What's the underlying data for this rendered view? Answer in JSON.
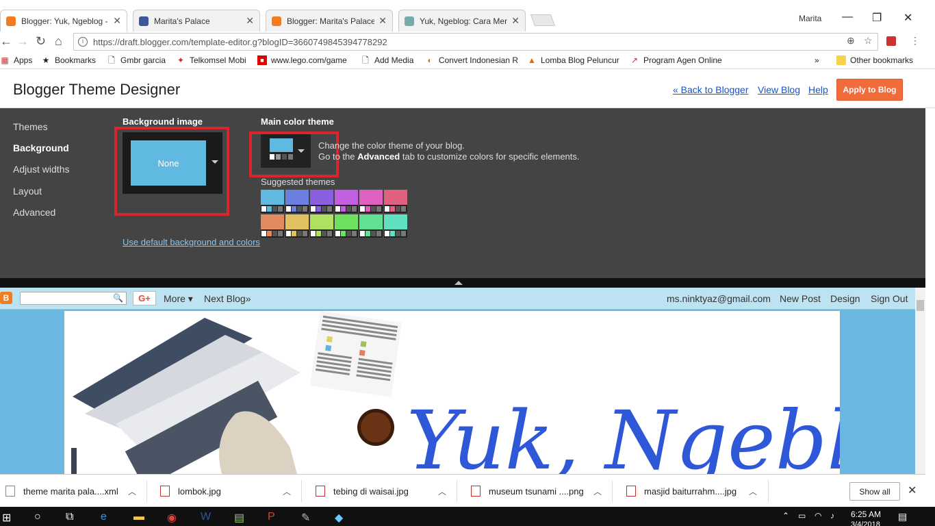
{
  "tabs": [
    {
      "title": "Blogger: Yuk, Ngeblog - T",
      "active": true,
      "favicon_color": "#f47c20"
    },
    {
      "title": "Marita's Palace",
      "active": false,
      "favicon_color": "#3b5998"
    },
    {
      "title": "Blogger: Marita's Palace",
      "active": false,
      "favicon_color": "#f47c20"
    },
    {
      "title": "Yuk, Ngeblog: Cara Mem",
      "active": false,
      "favicon_color": "#7aa"
    }
  ],
  "window": {
    "user": "Marita",
    "minimize": "—",
    "restore": "❐",
    "close": "✕"
  },
  "omnibox": {
    "url": "https://draft.blogger.com/template-editor.g?blogID=3660749845394778292"
  },
  "bookmarks": [
    {
      "label": "Apps",
      "icon": "apps-grid-icon"
    },
    {
      "label": "Bookmarks",
      "icon": "star-icon"
    },
    {
      "label": "Gmbr garcia",
      "icon": "page-icon"
    },
    {
      "label": "Telkomsel Mobi",
      "icon": "telkomsel-icon"
    },
    {
      "label": "www.lego.com/game",
      "icon": "lego-icon"
    },
    {
      "label": "Add Media",
      "icon": "page-icon"
    },
    {
      "label": "Convert Indonesian R",
      "icon": "convert-icon"
    },
    {
      "label": "Lomba Blog Peluncur",
      "icon": "lomba-icon"
    },
    {
      "label": "Program Agen Online",
      "icon": "agen-icon"
    }
  ],
  "bookmarks_more": "»",
  "other_bookmarks": "Other bookmarks",
  "designer": {
    "title": "Blogger Theme Designer",
    "links": [
      "« Back to Blogger",
      "View Blog",
      "Help"
    ],
    "apply": "Apply to Blog"
  },
  "nav": [
    "Themes",
    "Background",
    "Adjust widths",
    "Layout",
    "Advanced"
  ],
  "nav_selected": 1,
  "background": {
    "heading": "Background image",
    "preview_label": "None",
    "preview_color": "#60b9e0"
  },
  "color_theme": {
    "heading": "Main color theme",
    "desc1": "Change the color theme of your blog.",
    "desc2_pre": "Go to the ",
    "desc2_bold": "Advanced",
    "desc2_post": " tab to customize colors for specific elements."
  },
  "suggested_label": "Suggested themes",
  "swatches": [
    "#60b9e0",
    "#6a7fe0",
    "#8a60e0",
    "#c060e0",
    "#e060c0",
    "#e06080",
    "#e08a60",
    "#e0c060",
    "#b0e060",
    "#70e060",
    "#60e090",
    "#60e0c0"
  ],
  "default_link": "Use default background and colors",
  "navbar": {
    "search_placeholder": "",
    "gplus": "G+",
    "more": "More ▾",
    "next_blog": "Next Blog»",
    "email": "ms.ninktyaz@gmail.com",
    "new_post": "New Post",
    "design": "Design",
    "sign_out": "Sign Out"
  },
  "blog_title_art": "Yuk, Ngeblog!",
  "downloads": [
    {
      "name": "theme marita pala....xml",
      "type": "xml"
    },
    {
      "name": "lombok.jpg",
      "type": "img"
    },
    {
      "name": "tebing di waisai.jpg",
      "type": "img"
    },
    {
      "name": "museum tsunami ....png",
      "type": "img"
    },
    {
      "name": "masjid baiturrahm....jpg",
      "type": "img"
    }
  ],
  "show_all": "Show all",
  "clock": {
    "time": "6:25 AM",
    "date": "3/4/2018"
  }
}
